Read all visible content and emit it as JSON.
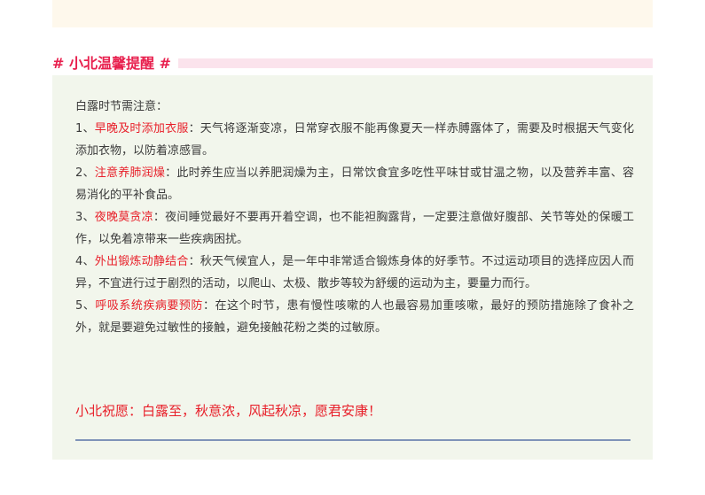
{
  "section_title": "# 小北温馨提醒 #",
  "intro": "白露时节需注意：",
  "tips": [
    {
      "number": "1、",
      "keyword": "早晚及时添加衣服",
      "separator": "：",
      "text": "天气将逐渐变凉，日常穿衣服不能再像夏天一样赤膊露体了，需要及时根据天气变化添加衣物，以防着凉感冒。"
    },
    {
      "number": "2、",
      "keyword": "注意养肺润燥",
      "separator": "：",
      "text": "此时养生应当以养肥润燥为主，日常饮食宜多吃性平味甘或甘温之物，以及营养丰富、容易消化的平补食品。"
    },
    {
      "number": "3、",
      "keyword": "夜晚莫贪凉",
      "separator": "：",
      "text": "夜间睡觉最好不要再开着空调，也不能袒胸露背，一定要注意做好腹部、关节等处的保暖工作，以免着凉带来一些疾病困扰。"
    },
    {
      "number": "4、",
      "keyword": "外出锻炼动静结合",
      "separator": "：",
      "text": "秋天气候宜人，是一年中非常适合锻炼身体的好季节。不过运动项目的选择应因人而异，不宜进行过于剧烈的活动，以爬山、太极、散步等较为舒缓的运动为主，要量力而行。"
    },
    {
      "number": "5、",
      "keyword": "呼吸系统疾病要预防",
      "separator": "：",
      "text": "在这个时节，患有慢性咳嗽的人也最容易加重咳嗽，最好的预防措施除了食补之外，就是要避免过敏性的接触，避免接触花粉之类的过敏原。"
    }
  ],
  "closing": "小北祝愿：白露至，秋意浓，风起秋凉，愿君安康！",
  "colors": {
    "heading": "#e8204e",
    "keyword": "#e8202a",
    "body_text": "#3a3a3a",
    "card_background": "#f2f6ec",
    "top_card_background": "#fef8ec",
    "heading_band": "#fbe3ec",
    "divider": "#7f93b8"
  }
}
